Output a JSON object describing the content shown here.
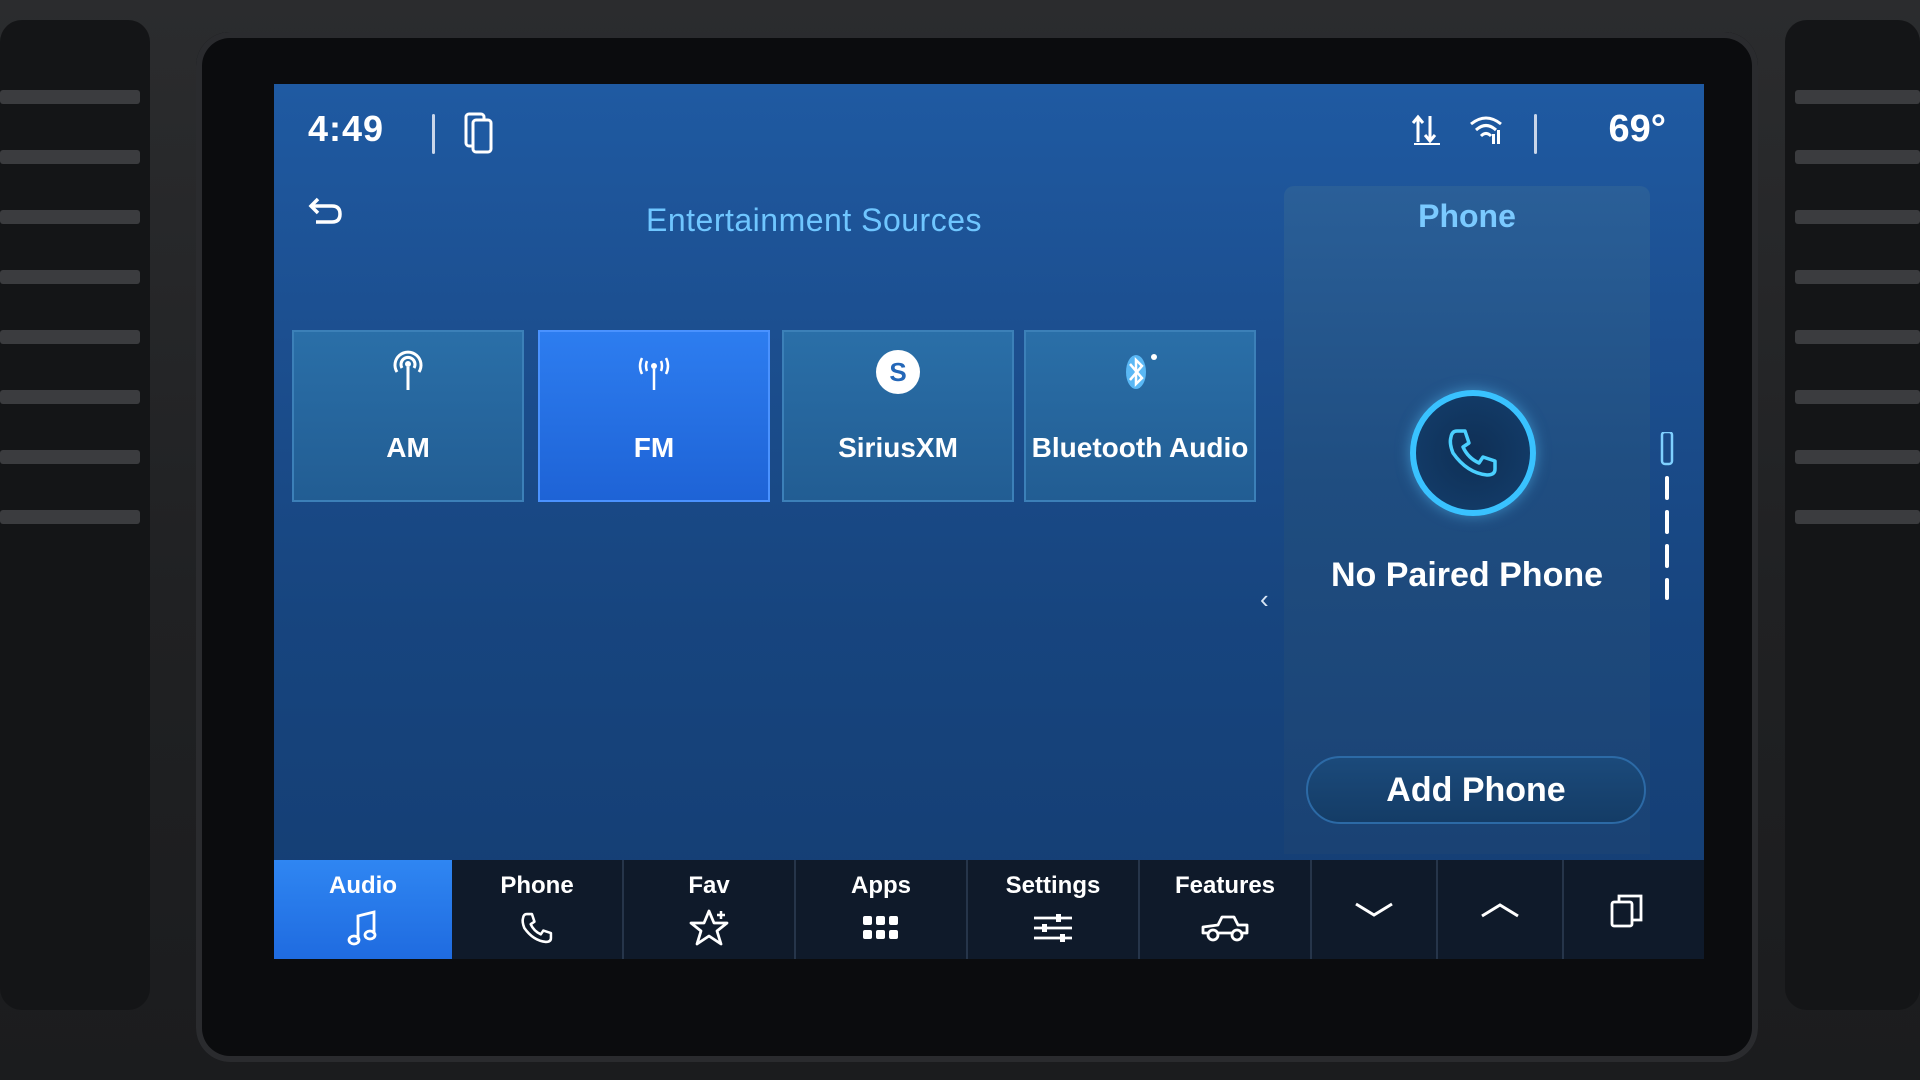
{
  "status_bar": {
    "time": "4:49",
    "temperature": "69°",
    "icons": [
      "phone-projection-icon",
      "data-transfer-icon",
      "wifi-icon"
    ]
  },
  "entertainment": {
    "title": "Entertainment Sources",
    "sources": [
      {
        "label": "AM",
        "icon": "am-antenna-icon",
        "active": false
      },
      {
        "label": "FM",
        "icon": "fm-antenna-icon",
        "active": true
      },
      {
        "label": "SiriusXM",
        "icon": "siriusxm-icon",
        "active": false
      },
      {
        "label": "Bluetooth Audio",
        "icon": "bluetooth-icon",
        "active": false
      }
    ]
  },
  "phone_panel": {
    "title": "Phone",
    "status": "No Paired Phone",
    "button": "Add Phone"
  },
  "nav": {
    "items": [
      {
        "label": "Audio",
        "icon": "music-note-icon",
        "active": true
      },
      {
        "label": "Phone",
        "icon": "phone-icon",
        "active": false
      },
      {
        "label": "Fav",
        "icon": "star-icon",
        "active": false
      },
      {
        "label": "Apps",
        "icon": "apps-grid-icon",
        "active": false
      },
      {
        "label": "Settings",
        "icon": "sliders-icon",
        "active": false
      },
      {
        "label": "Features",
        "icon": "truck-icon",
        "active": false
      }
    ],
    "extra_icons": [
      "chevron-down-icon",
      "chevron-up-icon",
      "windows-icon"
    ]
  },
  "colors": {
    "accent_blue": "#2d7df0",
    "title_cyan": "#6fc6ff",
    "phone_ring": "#39c2ff",
    "screen_top": "#1f5aa2",
    "navbar_bg": "#0f1a2a"
  }
}
